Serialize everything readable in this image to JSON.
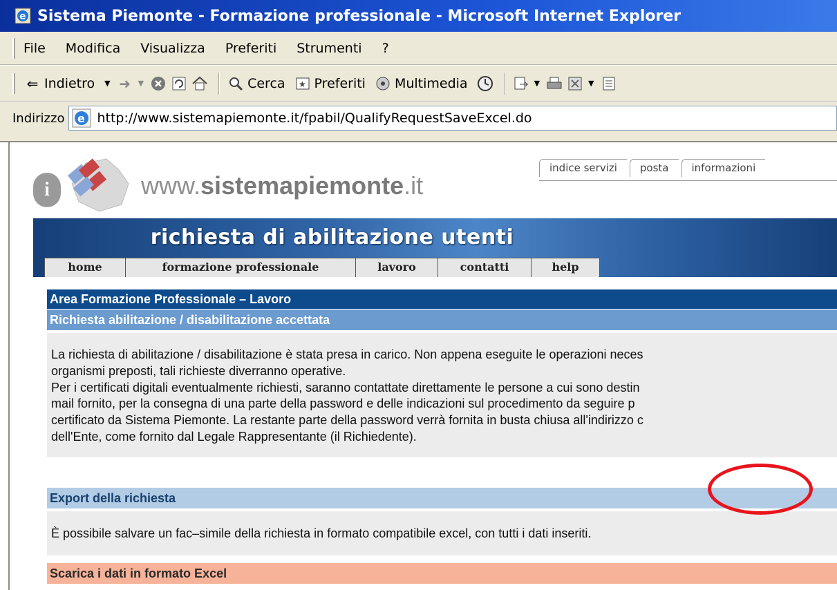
{
  "window": {
    "title": "Sistema Piemonte - Formazione professionale - Microsoft Internet Explorer"
  },
  "menubar": {
    "items": [
      "File",
      "Modifica",
      "Visualizza",
      "Preferiti",
      "Strumenti",
      "?"
    ]
  },
  "toolbar": {
    "back_label": "Indietro",
    "search_label": "Cerca",
    "favorites_label": "Preferiti",
    "media_label": "Multimedia"
  },
  "address": {
    "label": "Indirizzo",
    "url": "http://www.sistemapiemonte.it/fpabil/QualifyRequestSaveExcel.do"
  },
  "site": {
    "logo_prefix": "www.",
    "logo_name": "sistemapiemonte",
    "logo_suffix": ".it",
    "top_links": [
      "indice servizi",
      "posta",
      "informazioni"
    ],
    "banner_title": "richiesta di abilitazione utenti",
    "nav": [
      "home",
      "formazione professionale",
      "lavoro",
      "contatti",
      "help"
    ]
  },
  "main": {
    "area_title": "Area Formazione Professionale – Lavoro",
    "status_title": "Richiesta abilitazione / disabilitazione accettata",
    "message_lines": [
      "La richiesta di abilitazione / disabilitazione è stata presa in carico. Non appena eseguite le operazioni neces",
      "organismi preposti, tali richieste diverranno operative.",
      "Per i certificati digitali eventualmente richiesti, saranno contattate direttamente le persone a cui sono destin",
      "mail fornito, per la consegna di una parte della password e delle indicazioni sul procedimento da seguire p",
      "certificato da Sistema Piemonte. La restante parte della password verrà fornita in busta chiusa all'indirizzo c",
      "dell'Ente, come fornito dal Legale Rappresentante (il Richiedente)."
    ],
    "export_title": "Export della richiesta",
    "export_text": "È possibile salvare un fac–simile della richiesta in formato compatibile excel, con tutti i dati inseriti.",
    "download_title": "Scarica i dati in formato Excel"
  },
  "colors": {
    "title_bar": "#1d56d8",
    "area_bar": "#0e4b8c",
    "status_bar": "#6b9bcf",
    "export_bar": "#b3cce6",
    "download_bar": "#f7b399",
    "annotation": "#e8141c"
  }
}
